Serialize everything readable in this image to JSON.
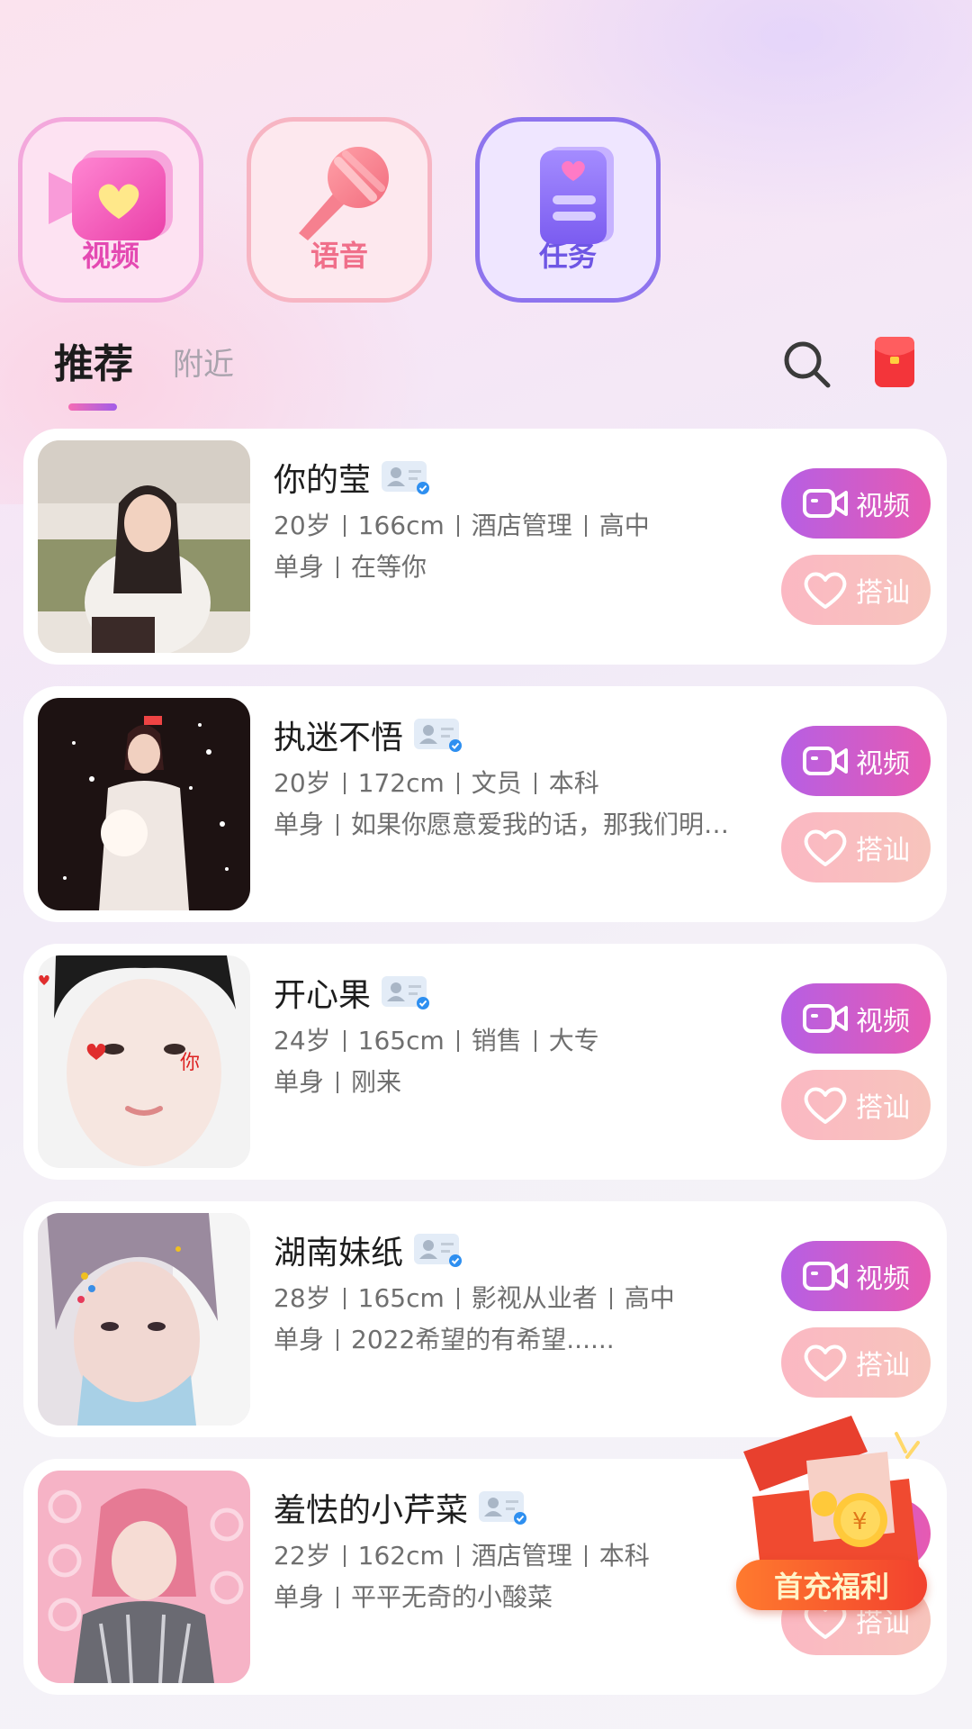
{
  "categories": [
    {
      "label": "视频",
      "icon": "video-heart-icon"
    },
    {
      "label": "语音",
      "icon": "microphone-icon"
    },
    {
      "label": "任务",
      "icon": "task-list-icon"
    }
  ],
  "tabs": [
    {
      "label": "推荐",
      "active": true
    },
    {
      "label": "附近",
      "active": false
    }
  ],
  "header_icons": [
    "search-icon",
    "red-packet-icon"
  ],
  "buttons": {
    "video": "视频",
    "chat": "搭讪"
  },
  "users": [
    {
      "name": "你的莹",
      "age": "20岁",
      "height": "166cm",
      "job": "酒店管理",
      "education": "高中",
      "status": "单身",
      "bio": "在等你"
    },
    {
      "name": "执迷不悟",
      "age": "20岁",
      "height": "172cm",
      "job": "文员",
      "education": "本科",
      "status": "单身",
      "bio": "如果你愿意爱我的话，那我们明…"
    },
    {
      "name": "开心果",
      "age": "24岁",
      "height": "165cm",
      "job": "销售",
      "education": "大专",
      "status": "单身",
      "bio": "刚来"
    },
    {
      "name": "湖南妹纸",
      "age": "28岁",
      "height": "165cm",
      "job": "影视从业者",
      "education": "高中",
      "status": "单身",
      "bio": "2022希望的有希望......"
    },
    {
      "name": "羞怯的小芹菜",
      "age": "22岁",
      "height": "162cm",
      "job": "酒店管理",
      "education": "本科",
      "status": "单身",
      "bio": "平平无奇的小酸菜"
    }
  ],
  "promo": {
    "label": "首充福利"
  },
  "colors": {
    "accent_purple": "#b65fe4",
    "accent_pink": "#e65ab2",
    "chat_pink": "#fbb8c3",
    "promo_orange": "#f2412e"
  }
}
